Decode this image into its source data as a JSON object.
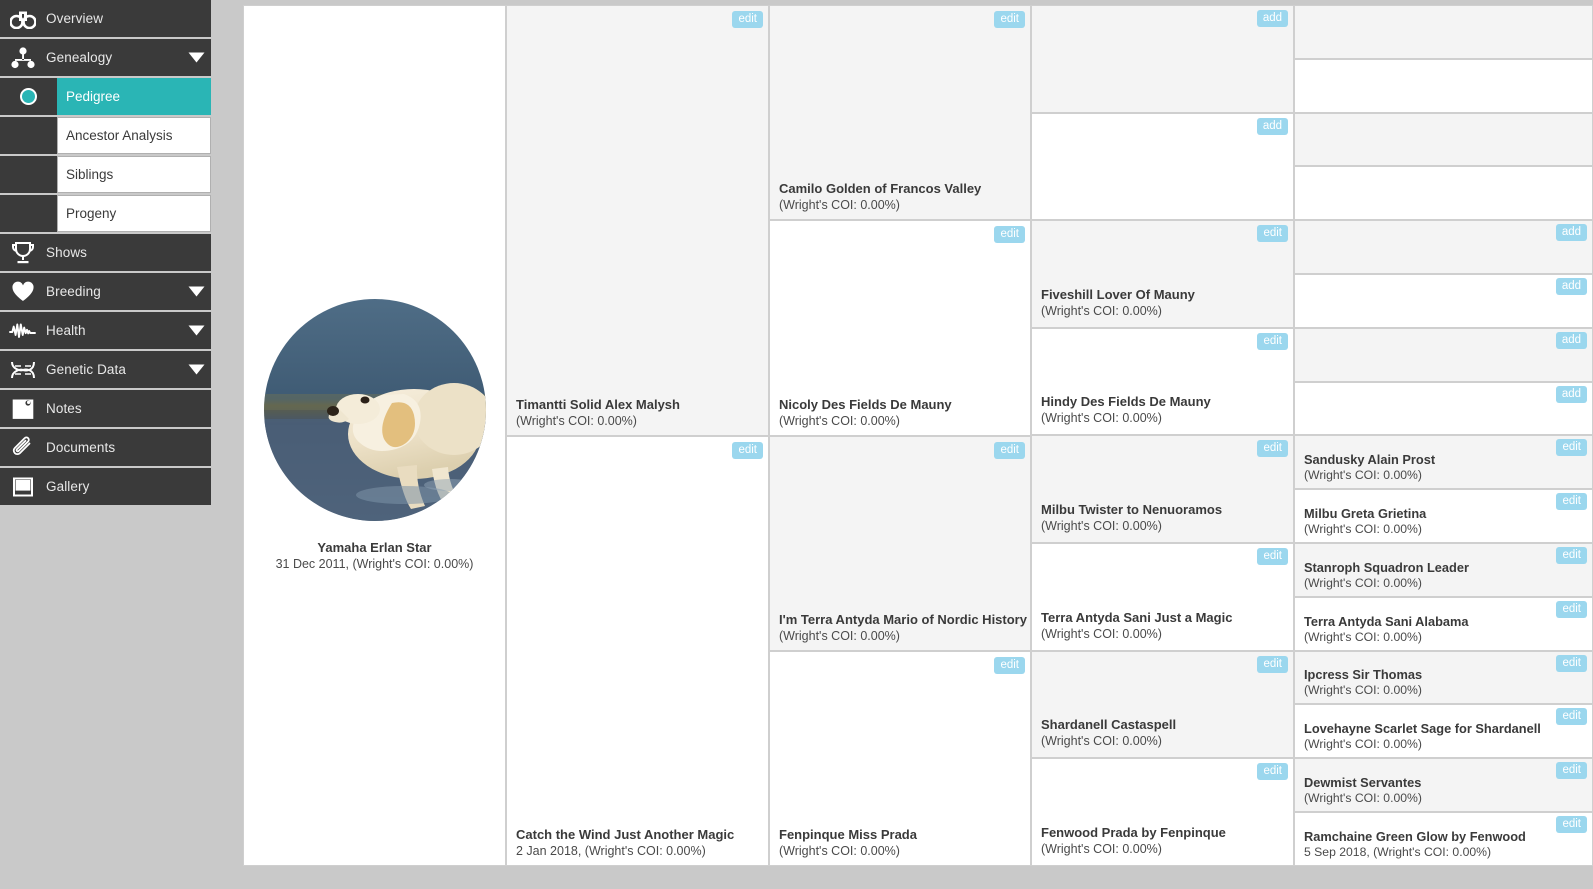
{
  "sidebar": {
    "items": [
      {
        "label": "Overview",
        "icon": "binoculars-icon",
        "caret": false,
        "key": "overview"
      },
      {
        "label": "Genealogy",
        "icon": "genealogy-icon",
        "caret": true,
        "key": "genealogy"
      },
      {
        "label": "Shows",
        "icon": "trophy-icon",
        "caret": false,
        "key": "shows"
      },
      {
        "label": "Breeding",
        "icon": "heart-icon",
        "caret": true,
        "key": "breeding"
      },
      {
        "label": "Health",
        "icon": "heartbeat-icon",
        "caret": true,
        "key": "health"
      },
      {
        "label": "Genetic Data",
        "icon": "dna-icon",
        "caret": true,
        "key": "genetic-data"
      },
      {
        "label": "Notes",
        "icon": "note-icon",
        "caret": false,
        "key": "notes"
      },
      {
        "label": "Documents",
        "icon": "paperclip-icon",
        "caret": false,
        "key": "documents"
      },
      {
        "label": "Gallery",
        "icon": "gallery-icon",
        "caret": false,
        "key": "gallery"
      }
    ],
    "subitems": [
      {
        "label": "Pedigree",
        "active": true
      },
      {
        "label": "Ancestor Analysis",
        "active": false
      },
      {
        "label": "Siblings",
        "active": false
      },
      {
        "label": "Progeny",
        "active": false
      }
    ]
  },
  "colors": {
    "accent": "#2ab5b5",
    "button": "#9bd7ee",
    "sidebar_bg": "#3a3a3a",
    "page_bg": "#c9c9c9"
  },
  "buttons": {
    "edit": "edit",
    "add": "add"
  },
  "subject": {
    "name": "Yamaha Erlan Star",
    "meta": "31 Dec 2011, (Wright's COI: 0.00%)",
    "photo_alt": "golden-retriever-puppy-in-water"
  },
  "gen2": [
    {
      "name": "Timantti Solid Alex Malysh",
      "meta": "(Wright's COI: 0.00%)",
      "action": "edit",
      "alt": true
    },
    {
      "name": "Catch the Wind Just Another Magic",
      "meta": "2 Jan 2018, (Wright's COI: 0.00%)",
      "action": "edit",
      "alt": false
    }
  ],
  "gen3": [
    {
      "name": "Camilo Golden of Francos Valley",
      "meta": "(Wright's COI: 0.00%)",
      "action": "edit",
      "alt": true
    },
    {
      "name": "Nicoly Des Fields De Mauny",
      "meta": "(Wright's COI: 0.00%)",
      "action": "edit",
      "alt": false
    },
    {
      "name": "I'm Terra Antyda Mario of Nordic History",
      "meta": "(Wright's COI: 0.00%)",
      "action": "edit",
      "alt": true
    },
    {
      "name": "Fenpinque Miss Prada",
      "meta": "(Wright's COI: 0.00%)",
      "action": "edit",
      "alt": false
    }
  ],
  "gen4": [
    {
      "name": "",
      "meta": "",
      "action": "add",
      "alt": true
    },
    {
      "name": "",
      "meta": "",
      "action": "add",
      "alt": false
    },
    {
      "name": "Fiveshill Lover Of Mauny",
      "meta": "(Wright's COI: 0.00%)",
      "action": "edit",
      "alt": true
    },
    {
      "name": "Hindy Des Fields De Mauny",
      "meta": "(Wright's COI: 0.00%)",
      "action": "edit",
      "alt": false
    },
    {
      "name": "Milbu Twister to Nenuoramos",
      "meta": "(Wright's COI: 0.00%)",
      "action": "edit",
      "alt": true
    },
    {
      "name": "Terra Antyda Sani Just a Magic",
      "meta": "(Wright's COI: 0.00%)",
      "action": "edit",
      "alt": false
    },
    {
      "name": "Shardanell Castaspell",
      "meta": "(Wright's COI: 0.00%)",
      "action": "edit",
      "alt": true
    },
    {
      "name": "Fenwood Prada by Fenpinque",
      "meta": "(Wright's COI: 0.00%)",
      "action": "edit",
      "alt": false
    }
  ],
  "gen5": [
    {
      "name": "",
      "meta": "",
      "action": "",
      "alt": true
    },
    {
      "name": "",
      "meta": "",
      "action": "",
      "alt": false
    },
    {
      "name": "",
      "meta": "",
      "action": "",
      "alt": true
    },
    {
      "name": "",
      "meta": "",
      "action": "",
      "alt": false
    },
    {
      "name": "",
      "meta": "",
      "action": "add",
      "alt": true
    },
    {
      "name": "",
      "meta": "",
      "action": "add",
      "alt": false
    },
    {
      "name": "",
      "meta": "",
      "action": "add",
      "alt": true
    },
    {
      "name": "",
      "meta": "",
      "action": "add",
      "alt": false
    },
    {
      "name": "Sandusky Alain Prost",
      "meta": "(Wright's COI: 0.00%)",
      "action": "edit",
      "alt": true
    },
    {
      "name": "Milbu Greta Grietina",
      "meta": "(Wright's COI: 0.00%)",
      "action": "edit",
      "alt": false
    },
    {
      "name": "Stanroph Squadron Leader",
      "meta": "(Wright's COI: 0.00%)",
      "action": "edit",
      "alt": true
    },
    {
      "name": "Terra Antyda Sani Alabama",
      "meta": "(Wright's COI: 0.00%)",
      "action": "edit",
      "alt": false
    },
    {
      "name": "Ipcress Sir Thomas",
      "meta": "(Wright's COI: 0.00%)",
      "action": "edit",
      "alt": true
    },
    {
      "name": "Lovehayne Scarlet Sage for Shardanell",
      "meta": "(Wright's COI: 0.00%)",
      "action": "edit",
      "alt": false
    },
    {
      "name": "Dewmist Servantes",
      "meta": "(Wright's COI: 0.00%)",
      "action": "edit",
      "alt": true
    },
    {
      "name": "Ramchaine Green Glow by Fenwood",
      "meta": "5 Sep 2018, (Wright's COI: 0.00%)",
      "action": "edit",
      "alt": false
    }
  ]
}
